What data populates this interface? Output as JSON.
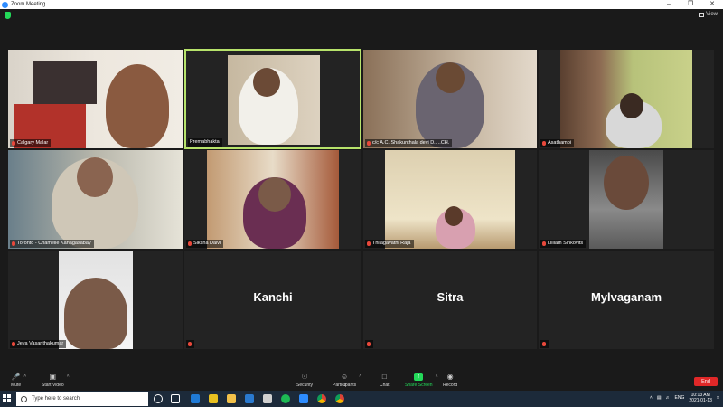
{
  "window": {
    "title": "Zoom Meeting",
    "controls": [
      "–",
      "❐",
      "✕"
    ]
  },
  "header": {
    "view_label": "View",
    "security_icon": "shield-icon"
  },
  "participants": [
    {
      "name": "Calgary Malar",
      "muted": true
    },
    {
      "name": "Premabhakta",
      "muted": false,
      "active_speaker": true
    },
    {
      "name": "c/c A.C. Shakunthala devi  D.. ..CH.",
      "muted": true
    },
    {
      "name": "Asathambi",
      "muted": true
    },
    {
      "name": "Toronto - Chamelie Kanagasabay",
      "muted": true
    },
    {
      "name": "Siksha Dalvi",
      "muted": true
    },
    {
      "name": "Thilagavathi Raja",
      "muted": true
    },
    {
      "name": "Lilliam Sinkovits",
      "muted": true
    },
    {
      "name": "Jeya Vasanthakumar",
      "muted": true
    },
    {
      "name": "Kanchi",
      "muted": true,
      "video_off": true
    },
    {
      "name": "Sitra",
      "muted": true,
      "video_off": true
    },
    {
      "name": "Mylvaganam",
      "muted": true,
      "video_off": true
    }
  ],
  "toolbar": {
    "mute": "Mute",
    "start_video": "Start Video",
    "security": "Security",
    "participants": "Participants",
    "participant_count": "12",
    "chat": "Chat",
    "share_screen": "Share Screen",
    "record": "Record",
    "end": "End"
  },
  "taskbar": {
    "search_placeholder": "Type here to search",
    "language": "ENG",
    "time": "10:13 AM",
    "date": "2021-01-13"
  },
  "colors": {
    "active_speaker_border": "#b7e36b",
    "share_green": "#23d959",
    "end_red": "#e02828",
    "muted_red": "#e8483b"
  }
}
